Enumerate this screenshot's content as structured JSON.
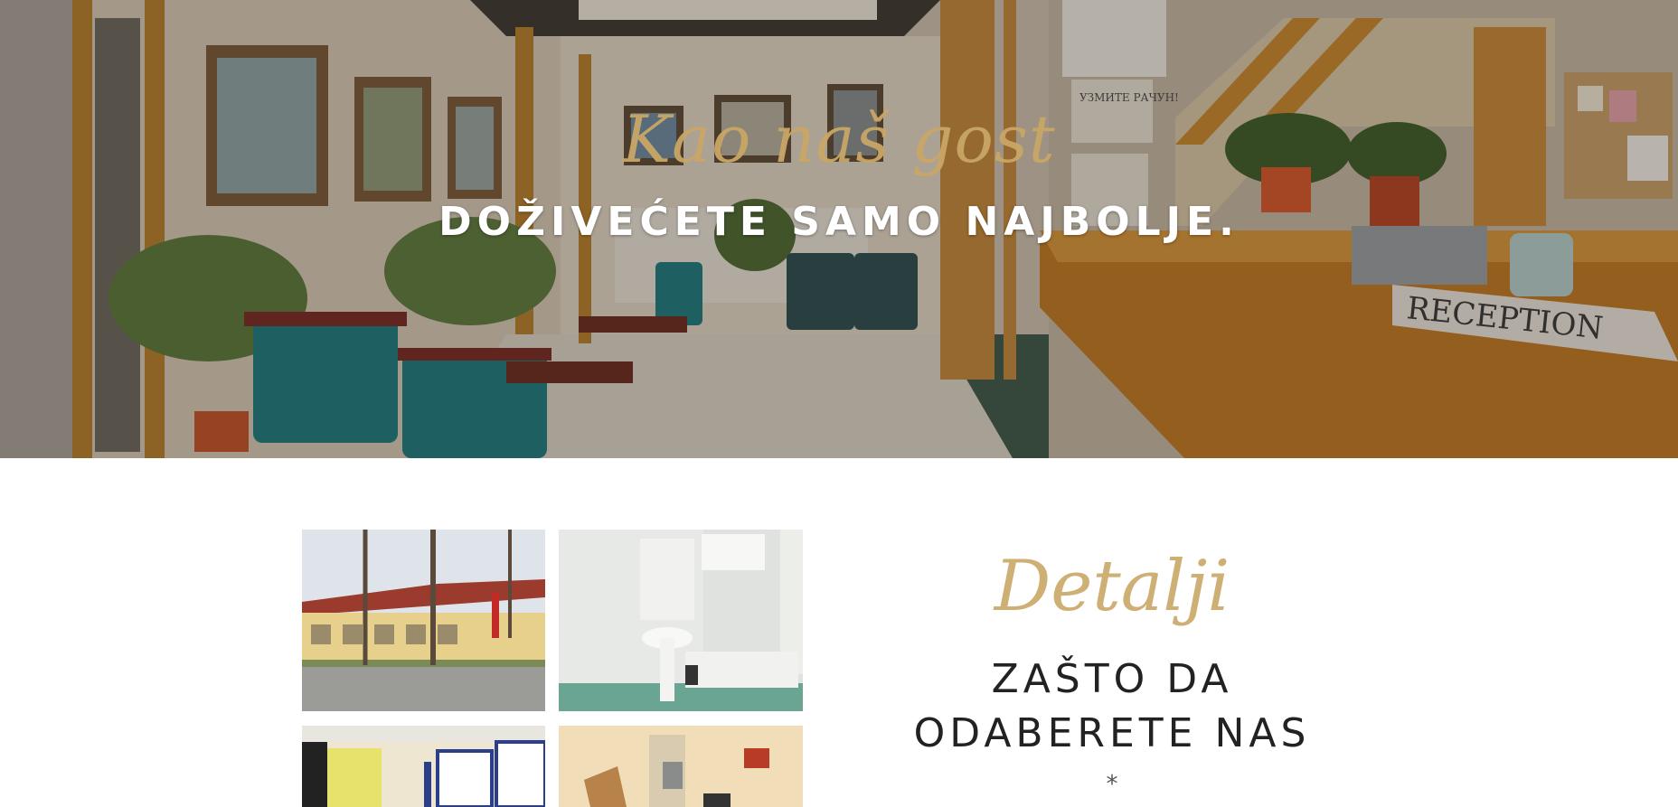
{
  "hero": {
    "script_text": "Kao naš gost",
    "title": "DOŽIVEĆETE SAMO NAJBOLJE.",
    "reception_sign": "RECEPTION",
    "notice_text": "УЗМИТЕ РАЧУН!"
  },
  "gallery": {
    "images": [
      {
        "name": "hotel-exterior-photo",
        "icon": "building-exterior"
      },
      {
        "name": "bathroom-photo",
        "icon": "bathroom"
      },
      {
        "name": "conference-room-photo",
        "icon": "room-interior"
      },
      {
        "name": "bedroom-photo",
        "icon": "bedroom"
      }
    ]
  },
  "details": {
    "script_text": "Detalji",
    "title_line1": "ZAŠTO DA",
    "title_line2": "ODABERETE NAS",
    "asterisk": "*"
  },
  "colors": {
    "gold_accent": "#c9a766",
    "hero_title": "#ffffff",
    "heading_dark": "#222222",
    "page_background": "#ffffff"
  }
}
